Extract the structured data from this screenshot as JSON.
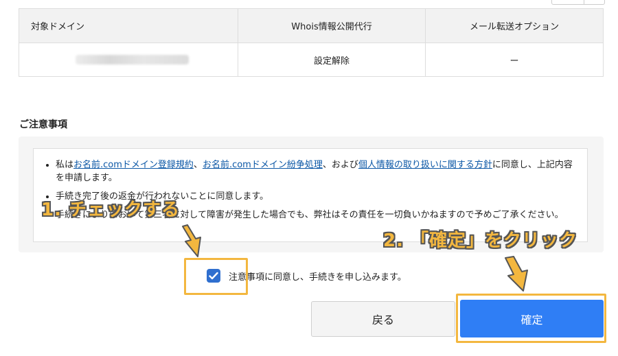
{
  "domain_table": {
    "headers": [
      "対象ドメイン",
      "Whois情報公開代行",
      "メール転送オプション"
    ],
    "row": {
      "whois": "設定解除",
      "mail": "ー"
    }
  },
  "notes": {
    "heading": "ご注意事項",
    "item1": {
      "prefix": "私は",
      "link1": "お名前.comドメイン登録規約",
      "sep1": "、",
      "link2": "お名前.comドメイン紛争処理",
      "sep2": "、および",
      "link3": "個人情報の取り扱いに関する方針",
      "suffix": "に同意し、上記内容を申請します。"
    },
    "item2": "手続き完了後の返金が行われないことに同意します。",
    "item3": "手続きによりにおいて第三者に対して障害が発生した場合でも、弊社はその責任を一切負いかねますので予めご了承ください。"
  },
  "agree_label": "注意事項に同意し、手続きを申し込みます。",
  "buttons": {
    "back": "戻る",
    "confirm": "確定"
  },
  "annotations": {
    "step1": "1. チェックする",
    "step2": "2. 「確定」をクリック"
  },
  "colors": {
    "primary": "#2f7ef5",
    "highlight": "#f3b73f",
    "link": "#0b57a6"
  }
}
